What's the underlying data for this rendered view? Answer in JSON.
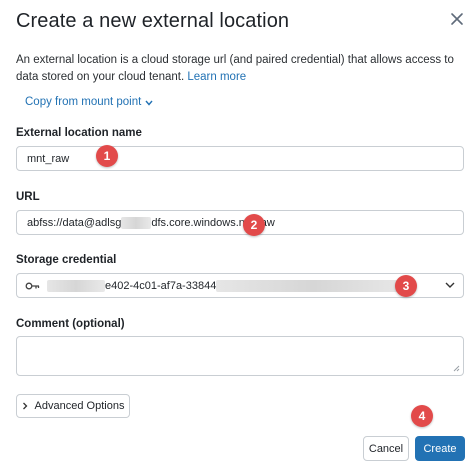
{
  "dialog": {
    "title": "Create a new external location",
    "description": "An external location is a cloud storage url (and paired credential) that allows access to data stored on your cloud tenant.",
    "learn_more": "Learn more",
    "copy_from_mount": "Copy from mount point"
  },
  "fields": {
    "name": {
      "label": "External location name",
      "value": "mnt_raw"
    },
    "url": {
      "label": "URL",
      "value_prefix": "abfss://data@adlsg",
      "value_suffix": "dfs.core.windows.net/raw"
    },
    "credential": {
      "label": "Storage credential",
      "value_visible": "e402-4c01-af7a-33844"
    },
    "comment": {
      "label": "Comment (optional)",
      "value": ""
    }
  },
  "buttons": {
    "advanced": "Advanced Options",
    "cancel": "Cancel",
    "create": "Create"
  },
  "markers": [
    "1",
    "2",
    "3",
    "4"
  ],
  "colors": {
    "accent": "#2272b4",
    "marker": "#e24a4a"
  }
}
